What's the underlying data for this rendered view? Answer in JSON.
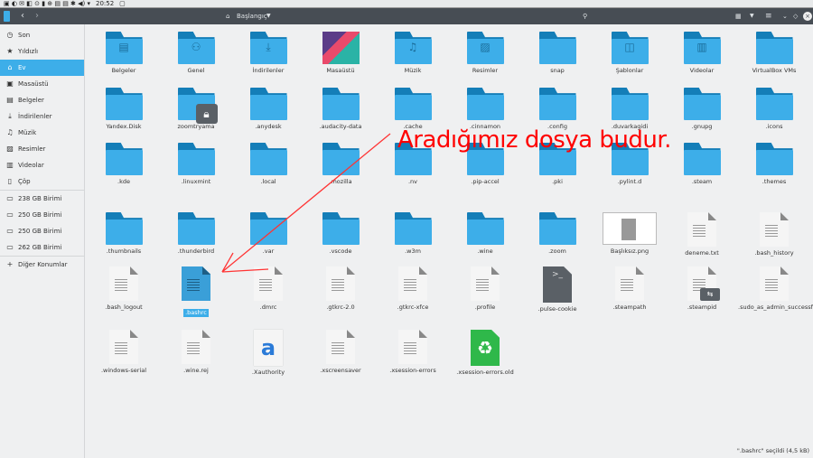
{
  "system_bar": {
    "clock": "20:52"
  },
  "titlebar": {
    "location": "Başlangıç"
  },
  "sidebar": {
    "places": [
      {
        "label": "Son",
        "icon": "clock-icon"
      },
      {
        "label": "Yıldızlı",
        "icon": "star-icon"
      },
      {
        "label": "Ev",
        "icon": "home-icon",
        "active": true
      },
      {
        "label": "Masaüstü",
        "icon": "desktop-icon"
      },
      {
        "label": "Belgeler",
        "icon": "documents-icon"
      },
      {
        "label": "İndirilenler",
        "icon": "download-icon"
      },
      {
        "label": "Müzik",
        "icon": "music-icon"
      },
      {
        "label": "Resimler",
        "icon": "pictures-icon"
      },
      {
        "label": "Videolar",
        "icon": "video-icon"
      },
      {
        "label": "Çöp",
        "icon": "trash-icon"
      }
    ],
    "drives": [
      {
        "label": "238 GB Birimi"
      },
      {
        "label": "250 GB Birimi"
      },
      {
        "label": "250 GB Birimi"
      },
      {
        "label": "262 GB Birimi"
      }
    ],
    "other": {
      "label": "Diğer Konumlar"
    }
  },
  "files": [
    {
      "name": "Belgeler",
      "type": "folder",
      "emblem": "documents"
    },
    {
      "name": "Genel",
      "type": "folder",
      "emblem": "share"
    },
    {
      "name": "İndirilenler",
      "type": "folder",
      "emblem": "download"
    },
    {
      "name": "Masaüstü",
      "type": "desktop"
    },
    {
      "name": "Müzik",
      "type": "folder",
      "emblem": "music"
    },
    {
      "name": "Resimler",
      "type": "folder",
      "emblem": "pictures"
    },
    {
      "name": "snap",
      "type": "folder"
    },
    {
      "name": "Şablonlar",
      "type": "folder",
      "emblem": "templates"
    },
    {
      "name": "Videolar",
      "type": "folder",
      "emblem": "video"
    },
    {
      "name": "VirtualBox VMs",
      "type": "folder"
    },
    {
      "name": "Yandex.Disk",
      "type": "folder"
    },
    {
      "name": "zoomtryama",
      "type": "folder",
      "emblem": "lock"
    },
    {
      "name": ".anydesk",
      "type": "folder"
    },
    {
      "name": ".audacity-data",
      "type": "folder"
    },
    {
      "name": ".cache",
      "type": "folder"
    },
    {
      "name": ".cinnamon",
      "type": "folder"
    },
    {
      "name": ".config",
      "type": "folder"
    },
    {
      "name": ".duvarkagidi",
      "type": "folder"
    },
    {
      "name": ".gnupg",
      "type": "folder"
    },
    {
      "name": ".icons",
      "type": "folder"
    },
    {
      "name": ".kde",
      "type": "folder"
    },
    {
      "name": ".linuxmint",
      "type": "folder"
    },
    {
      "name": ".local",
      "type": "folder"
    },
    {
      "name": ".mozilla",
      "type": "folder"
    },
    {
      "name": ".nv",
      "type": "folder"
    },
    {
      "name": ".pip-accel",
      "type": "folder"
    },
    {
      "name": ".pki",
      "type": "folder"
    },
    {
      "name": ".pylint.d",
      "type": "folder"
    },
    {
      "name": ".steam",
      "type": "folder"
    },
    {
      "name": ".themes",
      "type": "folder"
    },
    {
      "name": ".thumbnails",
      "type": "folder"
    },
    {
      "name": ".thunderbird",
      "type": "folder"
    },
    {
      "name": ".var",
      "type": "folder"
    },
    {
      "name": ".vscode",
      "type": "folder"
    },
    {
      "name": ".w3m",
      "type": "folder"
    },
    {
      "name": ".wine",
      "type": "folder"
    },
    {
      "name": ".zoom",
      "type": "folder"
    },
    {
      "name": "Başlıksız.png",
      "type": "image"
    },
    {
      "name": "deneme.txt",
      "type": "text"
    },
    {
      "name": ".bash_history",
      "type": "text"
    },
    {
      "name": ".bash_logout",
      "type": "text"
    },
    {
      "name": ".bashrc",
      "type": "text",
      "selected": true
    },
    {
      "name": ".dmrc",
      "type": "text"
    },
    {
      "name": ".gtkrc-2.0",
      "type": "text"
    },
    {
      "name": ".gtkrc-xfce",
      "type": "text"
    },
    {
      "name": ".profile",
      "type": "text"
    },
    {
      "name": ".pulse-cookie",
      "type": "binary"
    },
    {
      "name": ".steampath",
      "type": "text"
    },
    {
      "name": ".steampid",
      "type": "link"
    },
    {
      "name": ".sudo_as_admin_successful",
      "type": "text"
    },
    {
      "name": ".windows-serial",
      "type": "text"
    },
    {
      "name": ".wine.rej",
      "type": "text"
    },
    {
      "name": ".Xauthority",
      "type": "font"
    },
    {
      "name": ".xscreensaver",
      "type": "text"
    },
    {
      "name": ".xsession-errors",
      "type": "text"
    },
    {
      "name": ".xsession-errors.old",
      "type": "recycle"
    }
  ],
  "annotation": {
    "text": "Aradığımız dosya budur.",
    "color": "#ff0000"
  },
  "status": {
    "text": "\".bashrc\" seçildi (4,5 kB)"
  },
  "colors": {
    "accent": "#3daee9",
    "titlebar": "#474d54",
    "folder": "#3daee9"
  }
}
